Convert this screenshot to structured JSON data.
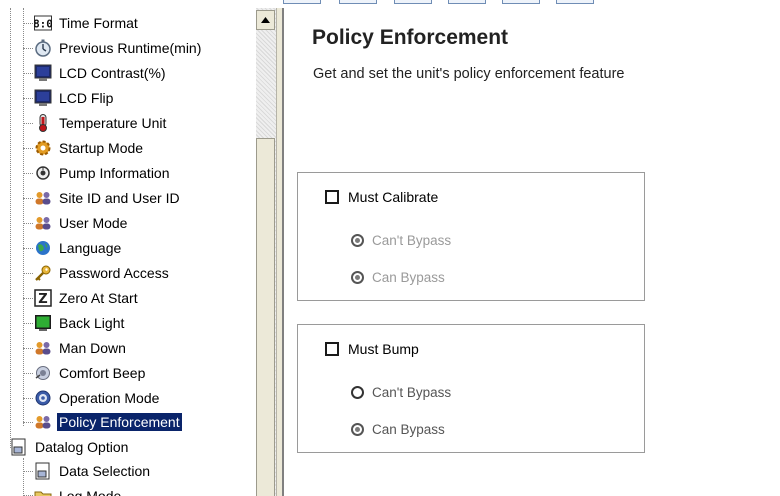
{
  "tree": {
    "items": [
      {
        "label": "Time Format",
        "icon": "clock-digits-icon"
      },
      {
        "label": "Previous Runtime(min)",
        "icon": "stopwatch-icon"
      },
      {
        "label": "LCD Contrast(%)",
        "icon": "monitor-icon"
      },
      {
        "label": "LCD Flip",
        "icon": "monitor-icon"
      },
      {
        "label": "Temperature Unit",
        "icon": "thermometer-icon"
      },
      {
        "label": "Startup Mode",
        "icon": "gear-icon"
      },
      {
        "label": "Pump Information",
        "icon": "pump-icon"
      },
      {
        "label": "Site ID and User ID",
        "icon": "users-icon"
      },
      {
        "label": "User Mode",
        "icon": "users-icon"
      },
      {
        "label": "Language",
        "icon": "globe-icon"
      },
      {
        "label": "Password Access",
        "icon": "key-icon"
      },
      {
        "label": "Zero At Start",
        "icon": "zero-icon"
      },
      {
        "label": "Back Light",
        "icon": "backlight-icon"
      },
      {
        "label": "Man Down",
        "icon": "users-icon"
      },
      {
        "label": "Comfort Beep",
        "icon": "beep-icon"
      },
      {
        "label": "Operation Mode",
        "icon": "operation-icon"
      },
      {
        "label": "Policy Enforcement",
        "icon": "users-icon"
      },
      {
        "label": "Datalog Option",
        "icon": "document-icon"
      },
      {
        "label": "Data Selection",
        "icon": "document-icon"
      },
      {
        "label": "Log Mode",
        "icon": "folder-icon"
      }
    ]
  },
  "panel": {
    "title": "Policy Enforcement",
    "subtitle": "Get and set the unit's policy enforcement feature",
    "groups": [
      {
        "checkbox": "Must Calibrate",
        "options": [
          "Can't Bypass",
          "Can Bypass"
        ]
      },
      {
        "checkbox": "Must Bump",
        "options": [
          "Can't Bypass",
          "Can Bypass"
        ]
      }
    ]
  },
  "colors": {
    "selection": "#0a246a",
    "border": "#9a9a9a"
  }
}
